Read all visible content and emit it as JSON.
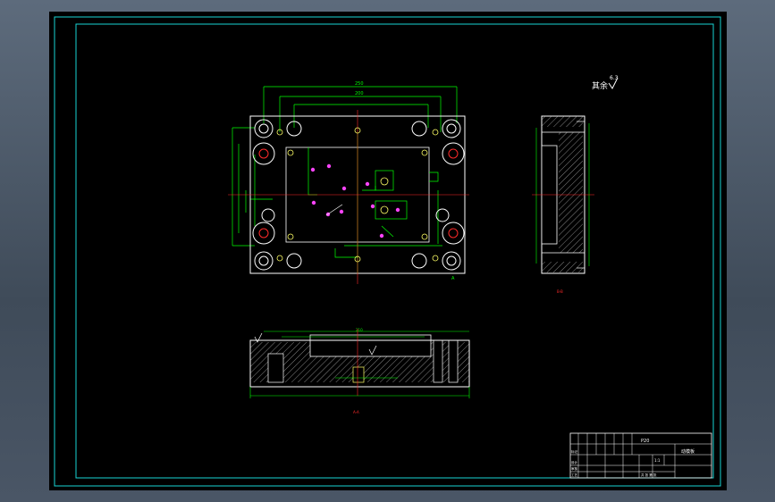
{
  "drawing": {
    "roughness_symbol": "其余",
    "roughness_value": "6.3",
    "title_block": {
      "material": "P20",
      "scale_text": "1:1",
      "drawing_name": "动模板",
      "row_labels": [
        "标记",
        "设计",
        "审核",
        "工艺"
      ],
      "sheet_text": "共 张 第 张"
    },
    "views": {
      "top_dims": [
        "250",
        "200"
      ],
      "section_label": "A-A",
      "side_label": "B-B",
      "plan_label": "A",
      "front_dims": [
        "210"
      ]
    }
  },
  "colors": {
    "border": "#19d4d4",
    "outline": "#ffffff",
    "dimension": "#00ff00",
    "center": "#ff2a2a",
    "hole": "#ff44ff",
    "hatch": "#cfcfcf",
    "annotation": "#ffff66"
  }
}
